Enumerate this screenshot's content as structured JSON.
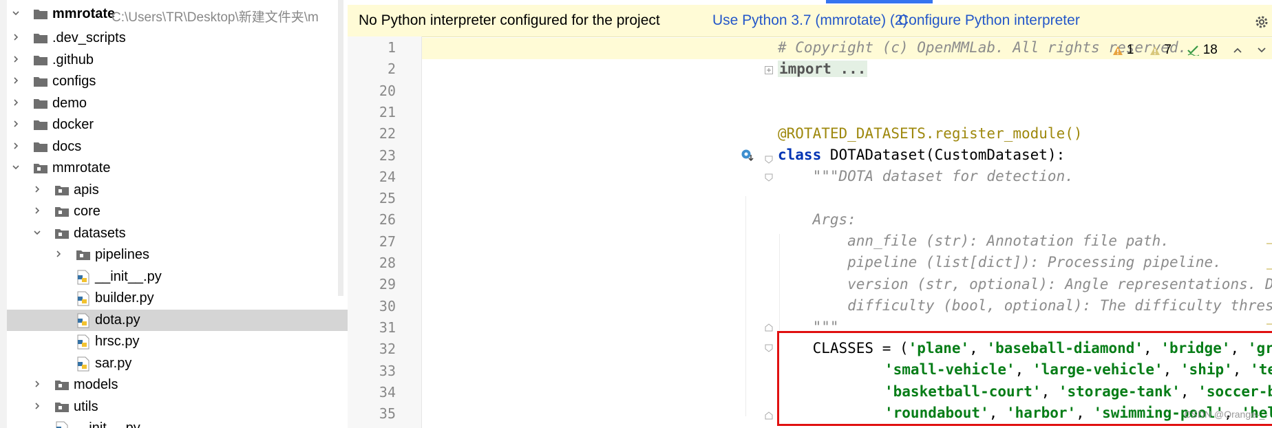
{
  "project": {
    "name": "mmrotate",
    "path": "C:\\Users\\TR\\Desktop\\新建文件夹\\m",
    "items": [
      {
        "label": ".dev_scripts",
        "type": "folder",
        "depth": 1,
        "expanded": false
      },
      {
        "label": ".github",
        "type": "folder",
        "depth": 1,
        "expanded": false
      },
      {
        "label": "configs",
        "type": "folder",
        "depth": 1,
        "expanded": false
      },
      {
        "label": "demo",
        "type": "folder",
        "depth": 1,
        "expanded": false
      },
      {
        "label": "docker",
        "type": "folder",
        "depth": 1,
        "expanded": false
      },
      {
        "label": "docs",
        "type": "folder",
        "depth": 1,
        "expanded": false
      },
      {
        "label": "mmrotate",
        "type": "package",
        "depth": 1,
        "expanded": true
      },
      {
        "label": "apis",
        "type": "package",
        "depth": 2,
        "expanded": false
      },
      {
        "label": "core",
        "type": "package",
        "depth": 2,
        "expanded": false
      },
      {
        "label": "datasets",
        "type": "package",
        "depth": 2,
        "expanded": true
      },
      {
        "label": "pipelines",
        "type": "package",
        "depth": 3,
        "expanded": false
      },
      {
        "label": "__init__.py",
        "type": "python-file",
        "depth": 3
      },
      {
        "label": "builder.py",
        "type": "python-file",
        "depth": 3
      },
      {
        "label": "dota.py",
        "type": "python-file",
        "depth": 3,
        "selected": true
      },
      {
        "label": "hrsc.py",
        "type": "python-file",
        "depth": 3
      },
      {
        "label": "sar.py",
        "type": "python-file",
        "depth": 3
      },
      {
        "label": "models",
        "type": "package",
        "depth": 2,
        "expanded": false
      },
      {
        "label": "utils",
        "type": "package",
        "depth": 2,
        "expanded": false
      },
      {
        "label": "__init__.py",
        "type": "python-file",
        "depth": 2
      }
    ]
  },
  "banner": {
    "message": "No Python interpreter configured for the project",
    "link_use": "Use Python 3.7 (mmrotate) (2)",
    "link_configure": "Configure Python interpreter"
  },
  "inspections": {
    "errors": "1",
    "warnings": "7",
    "ok": "18"
  },
  "editor": {
    "line_numbers": [
      "1",
      "2",
      "20",
      "21",
      "22",
      "23",
      "24",
      "25",
      "26",
      "27",
      "28",
      "29",
      "30",
      "31",
      "32",
      "33",
      "34",
      "35"
    ],
    "lines": {
      "l1": "# Copyright (c) OpenMMLab. All rights reserved.",
      "l2": "import ...",
      "l22": "@ROTATED_DATASETS.register_module()",
      "l23_kw": "class",
      "l23_rest": " DOTADataset(CustomDataset):",
      "l24": "    \"\"\"DOTA dataset for detection.",
      "l26": "    Args:",
      "l27": "        ann_file (str): Annotation file path.",
      "l28": "        pipeline (list[dict]): Processing pipeline.",
      "l29": "        version (str, optional): Angle representations. Defaults to 'oc'.",
      "l30": "        difficulty (bool, optional): The difficulty threshold of GT.",
      "l31": "    \"\"\"",
      "l32_pre": "    CLASSES = (",
      "classes": [
        "'plane'",
        "'baseball-diamond'",
        "'bridge'",
        "'ground-track-field'",
        "'small-vehicle'",
        "'large-vehicle'",
        "'ship'",
        "'tennis-court'",
        "'basketball-court'",
        "'storage-tank'",
        "'soccer-ball-field'",
        "'roundabout'",
        "'harbor'",
        "'swimming-pool'",
        "'helicopter'"
      ]
    }
  },
  "watermark": "CSDN @Orange-_-",
  "colors": {
    "banner_bg": "#fffbd6",
    "link": "#2457c9",
    "keyword": "#0033b3",
    "string": "#067d17",
    "decorator": "#9e880d",
    "comment": "#8c8c8c",
    "highlight_box": "#e01010",
    "selection": "#d5d5d5"
  }
}
